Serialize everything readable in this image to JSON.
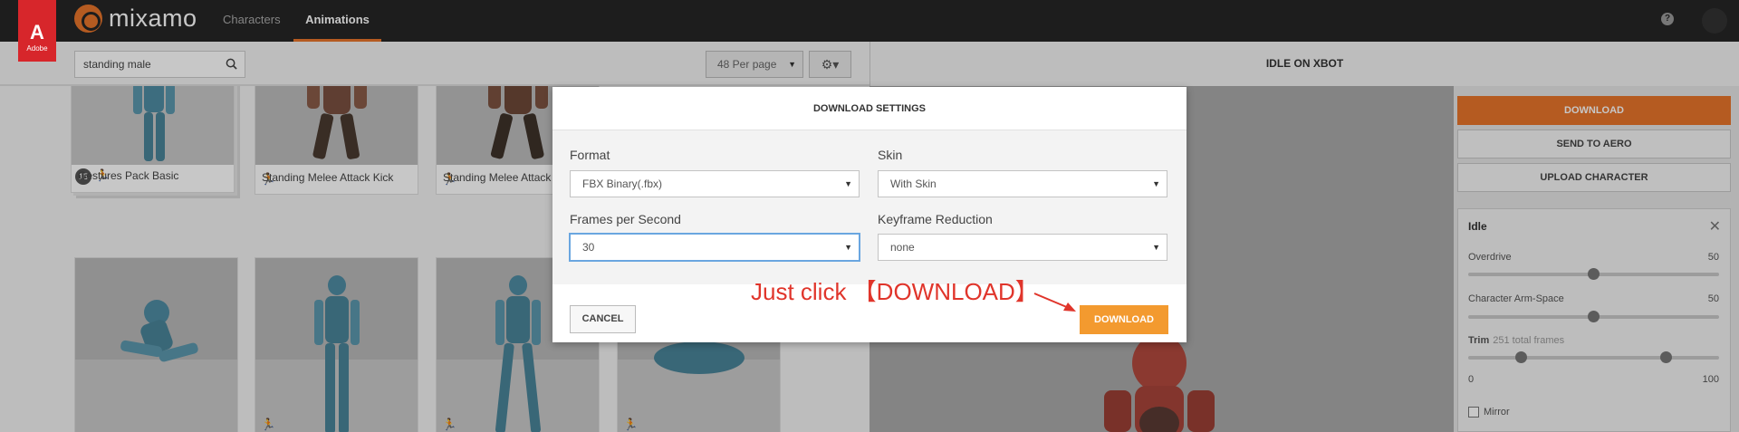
{
  "brand": {
    "logo_glyph": "A",
    "logo_word": "Adobe",
    "name": "mixamo"
  },
  "nav": {
    "characters": "Characters",
    "animations": "Animations"
  },
  "header": {
    "help": "?"
  },
  "search": {
    "value": "standing male"
  },
  "toolbar": {
    "per_page": "48 Per page",
    "gear": "⚙▾"
  },
  "cards": [
    {
      "label": "Gestures Pack Basic",
      "badge": "15"
    },
    {
      "label": "Standing Melee Attack Kick"
    },
    {
      "label": "Standing Melee Attack"
    },
    {
      "label": ""
    },
    {
      "label": ""
    },
    {
      "label": ""
    },
    {
      "label": ""
    }
  ],
  "preview": {
    "title": "IDLE ON XBOT"
  },
  "side": {
    "download": "DOWNLOAD",
    "send_to_aero": "SEND TO AERO",
    "upload_character": "UPLOAD CHARACTER",
    "panel_title": "Idle",
    "overdrive_label": "Overdrive",
    "overdrive_value": "50",
    "arm_space_label": "Character Arm-Space",
    "arm_space_value": "50",
    "trim_label": "Trim",
    "trim_frames": "251 total frames",
    "trim_min": "0",
    "trim_max": "100",
    "mirror_label": "Mirror"
  },
  "sliders": {
    "overdrive": 0.5,
    "arm_space": 0.5,
    "trim_start": 0.21,
    "trim_end": 0.79
  },
  "modal": {
    "title": "DOWNLOAD SETTINGS",
    "format_label": "Format",
    "format_value": "FBX Binary(.fbx)",
    "skin_label": "Skin",
    "skin_value": "With Skin",
    "fps_label": "Frames per Second",
    "fps_value": "30",
    "keyframe_label": "Keyframe Reduction",
    "keyframe_value": "none",
    "cancel": "CANCEL",
    "download": "DOWNLOAD"
  },
  "annotation": {
    "text": "Just click 【DOWNLOAD】"
  },
  "colors": {
    "accent": "#e8752b",
    "annotation": "#e0352b",
    "modal_download": "#f39a2f"
  }
}
